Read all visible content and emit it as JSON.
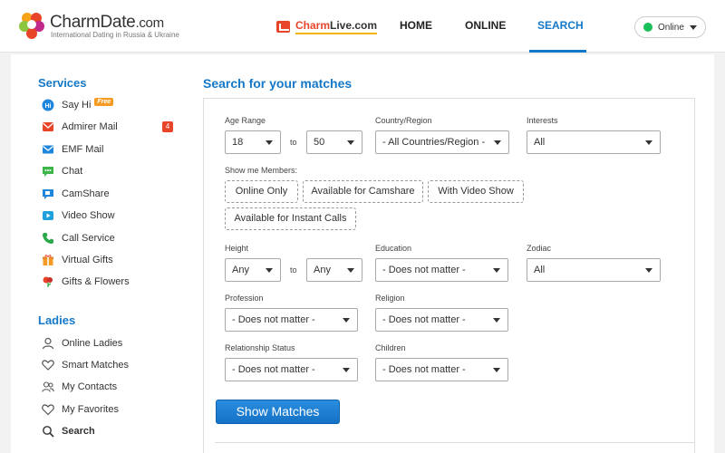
{
  "header": {
    "logo_name": "CharmDate",
    "logo_suffix": ".com",
    "tagline": "International Dating in Russia & Ukraine",
    "live_brand_red": "Charm",
    "live_brand_dark": "Live",
    "live_brand_suffix": ".com",
    "nav": {
      "home": "HOME",
      "online": "ONLINE",
      "search": "SEARCH"
    },
    "status": {
      "label": "Online",
      "color": "#1cc05a"
    }
  },
  "sidebar": {
    "services_title": "Services",
    "services": [
      {
        "label": "Say Hi",
        "icon": "say-hi-icon",
        "badge": "Free"
      },
      {
        "label": "Admirer Mail",
        "icon": "admirer-mail-icon",
        "count": "4"
      },
      {
        "label": "EMF Mail",
        "icon": "emf-mail-icon"
      },
      {
        "label": "Chat",
        "icon": "chat-icon"
      },
      {
        "label": "CamShare",
        "icon": "camshare-icon"
      },
      {
        "label": "Video Show",
        "icon": "video-show-icon"
      },
      {
        "label": "Call Service",
        "icon": "phone-icon"
      },
      {
        "label": "Virtual Gifts",
        "icon": "gift-icon"
      },
      {
        "label": "Gifts & Flowers",
        "icon": "flower-icon"
      }
    ],
    "ladies_title": "Ladies",
    "ladies": [
      {
        "label": "Online Ladies",
        "icon": "user-icon"
      },
      {
        "label": "Smart Matches",
        "icon": "hearts-icon"
      },
      {
        "label": "My Contacts",
        "icon": "contacts-icon"
      },
      {
        "label": "My Favorites",
        "icon": "heart-icon"
      },
      {
        "label": "Search",
        "icon": "search-icon"
      }
    ]
  },
  "search": {
    "title": "Search for your matches",
    "age_label": "Age Range",
    "age_from": "18",
    "age_to": "50",
    "to_label": "to",
    "country_label": "Country/Region",
    "country_value": "- All Countries/Region -",
    "interests_label": "Interests",
    "interests_value": "All",
    "show_members_label": "Show me Members:",
    "member_options": [
      "Online Only",
      "Available for Camshare",
      "With Video Show",
      "Available for Instant Calls"
    ],
    "height_label": "Height",
    "height_from": "Any",
    "height_to": "Any",
    "education_label": "Education",
    "education_value": "- Does not matter -",
    "zodiac_label": "Zodiac",
    "zodiac_value": "All",
    "profession_label": "Profession",
    "profession_value": "- Does not matter -",
    "religion_label": "Religion",
    "religion_value": "- Does not matter -",
    "relationship_label": "Relationship Status",
    "relationship_value": "- Does not matter -",
    "children_label": "Children",
    "children_value": "- Does not matter -",
    "submit_label": "Show Matches"
  }
}
